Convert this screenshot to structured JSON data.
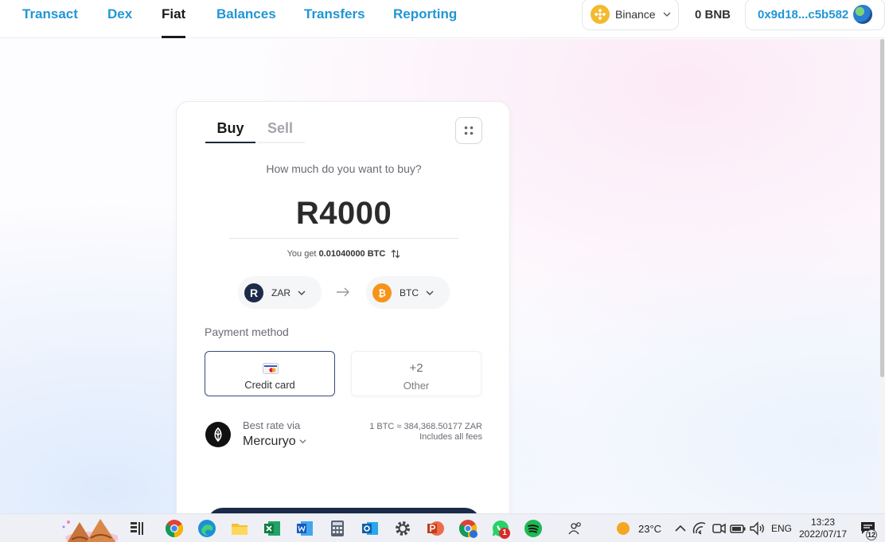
{
  "nav": {
    "tabs": [
      {
        "label": "Transact",
        "active": false
      },
      {
        "label": "Dex",
        "active": false
      },
      {
        "label": "Fiat",
        "active": true
      },
      {
        "label": "Balances",
        "active": false
      },
      {
        "label": "Transfers",
        "active": false
      },
      {
        "label": "Reporting",
        "active": false
      }
    ],
    "network": "Binance",
    "balance": "0 BNB",
    "wallet": "0x9d18...c5b582"
  },
  "widget": {
    "tabs": {
      "buy": "Buy",
      "sell": "Sell"
    },
    "question": "How much do you want to buy?",
    "amount": "R4000",
    "you_get_prefix": "You get",
    "you_get_value": "0.01040000 BTC",
    "from_currency": {
      "icon_letter": "R",
      "code": "ZAR"
    },
    "to_currency": {
      "icon": "bitcoin-icon",
      "code": "BTC"
    },
    "payment_method_label": "Payment method",
    "payment_methods": [
      {
        "label": "Credit card",
        "selected": true
      },
      {
        "count": "+2",
        "label": "Other",
        "selected": false
      }
    ],
    "best_rate_label": "Best rate via",
    "provider": "Mercuryo",
    "rate": "1 BTC ≈ 384,368.50177 ZAR",
    "fees_note": "Includes all fees"
  },
  "taskbar": {
    "weather": "23°C",
    "language": "ENG",
    "time": "13:23",
    "date": "2022/07/17",
    "whatsapp_badge": "1",
    "notification_count": "12"
  },
  "colors": {
    "nav_link": "#2196d6",
    "button_dark": "#1a2a48",
    "bnb": "#f3ba2f",
    "btc": "#f7931a"
  }
}
